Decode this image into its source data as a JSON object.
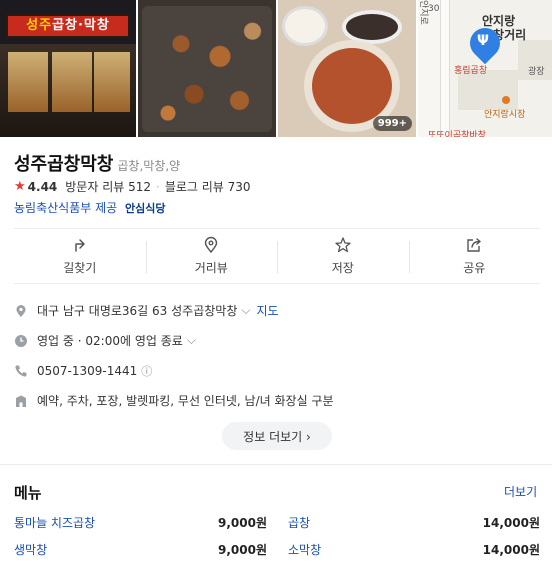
{
  "photos": {
    "sign_text_a": "성주",
    "sign_text_b": "곱창·막창",
    "count_badge": "999+",
    "map": {
      "labels": [
        "안지랑",
        "곱창거리",
        "홍림곱창",
        "안지랑시장",
        "또또이곱창바창",
        "안지로",
        "30",
        "광장"
      ]
    }
  },
  "place": {
    "name": "성주곱창막창",
    "category": "곱창,막창,양",
    "rating": "4.44",
    "visitor_reviews": "방문자 리뷰 512",
    "blog_reviews": "블로그 리뷰 730",
    "provider": "농림축산식품부 제공",
    "safe_badge": "안심식당"
  },
  "actions": [
    {
      "label": "길찾기",
      "icon": "directions-icon"
    },
    {
      "label": "거리뷰",
      "icon": "location-pin-icon"
    },
    {
      "label": "저장",
      "icon": "star-icon"
    },
    {
      "label": "공유",
      "icon": "share-icon"
    }
  ],
  "info": {
    "address": "대구 남구 대명로36길 63 성주곱창막창",
    "map_link": "지도",
    "hours_status": "영업 중",
    "hours_detail": "· 02:00에 영업 종료",
    "phone": "0507-1309-1441",
    "amenities": "예약, 주차, 포장, 발렛파킹, 무선 인터넷, 남/녀 화장실 구분",
    "more_info_button": "정보 더보기 ›"
  },
  "menu": {
    "title": "메뉴",
    "more": "더보기",
    "items": [
      {
        "name": "통마늘 치즈곱창",
        "price": "9,000원"
      },
      {
        "name": "곱창",
        "price": "14,000원"
      },
      {
        "name": "생막창",
        "price": "9,000원"
      },
      {
        "name": "소막창",
        "price": "14,000원"
      }
    ]
  },
  "colors": {
    "link": "#1a4fb5",
    "star": "#e33c33",
    "pin": "#2f7fe5"
  }
}
